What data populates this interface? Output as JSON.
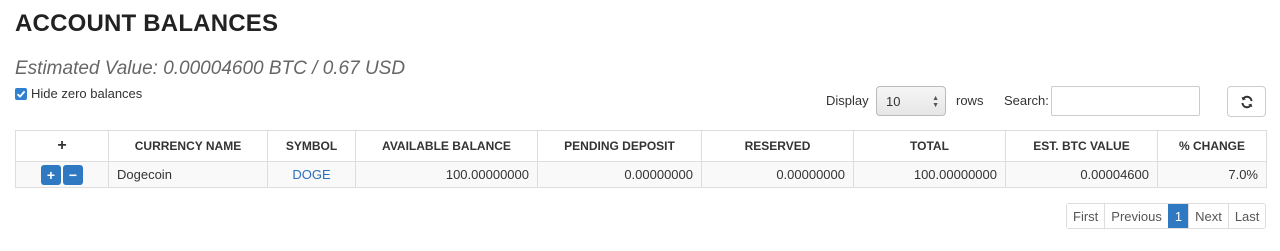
{
  "page": {
    "title": "ACCOUNT BALANCES",
    "estimated_value": "Estimated Value: 0.00004600 BTC / 0.67 USD"
  },
  "filters": {
    "hide_zero_label": "Hide zero balances",
    "hide_zero_checked": true
  },
  "controls": {
    "display_label": "Display",
    "display_value": "10",
    "rows_label": "rows",
    "search_label": "Search:",
    "search_value": ""
  },
  "table": {
    "headers": [
      "+",
      "CURRENCY NAME",
      "SYMBOL",
      "AVAILABLE BALANCE",
      "PENDING DEPOSIT",
      "RESERVED",
      "TOTAL",
      "EST. BTC VALUE",
      "% CHANGE"
    ],
    "rows": [
      {
        "currency_name": "Dogecoin",
        "symbol": "DOGE",
        "available_balance": "100.00000000",
        "pending_deposit": "0.00000000",
        "reserved": "0.00000000",
        "total": "100.00000000",
        "est_btc_value": "0.00004600",
        "pct_change": "7.0%"
      }
    ]
  },
  "pagination": {
    "first": "First",
    "previous": "Previous",
    "current": "1",
    "next": "Next",
    "last": "Last"
  },
  "colors": {
    "accent": "#2f79c2",
    "link": "#2a6ebb"
  },
  "icons": {
    "refresh": "refresh-icon",
    "checkbox": "checkbox-checked-icon",
    "deposit": "plus-icon",
    "withdraw": "minus-icon"
  }
}
